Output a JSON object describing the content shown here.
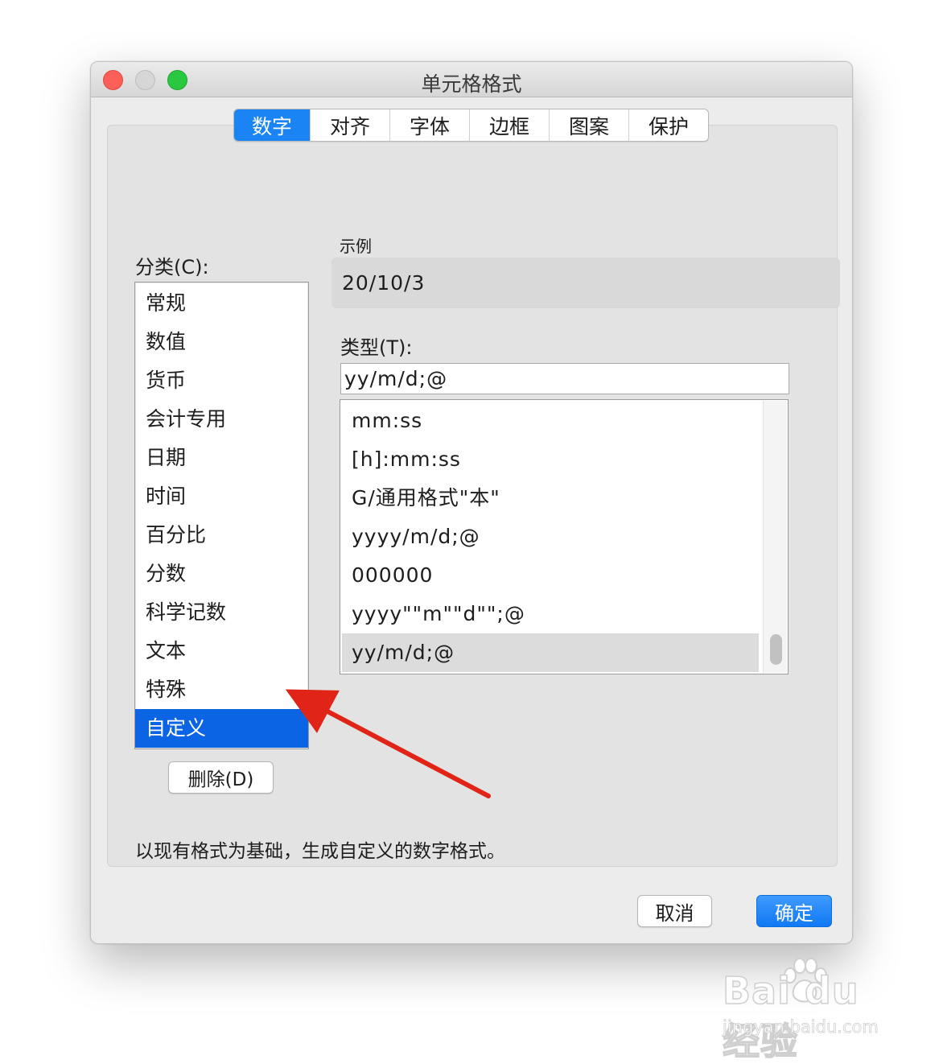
{
  "window": {
    "title": "单元格格式"
  },
  "tabs": [
    {
      "label": "数字",
      "active": true
    },
    {
      "label": "对齐",
      "active": false
    },
    {
      "label": "字体",
      "active": false
    },
    {
      "label": "边框",
      "active": false
    },
    {
      "label": "图案",
      "active": false
    },
    {
      "label": "保护",
      "active": false
    }
  ],
  "category": {
    "label": "分类(C):",
    "items": [
      "常规",
      "数值",
      "货币",
      "会计专用",
      "日期",
      "时间",
      "百分比",
      "分数",
      "科学记数",
      "文本",
      "特殊",
      "自定义"
    ],
    "selected": "自定义"
  },
  "delete_button": "删除(D)",
  "sample": {
    "label": "示例",
    "value": "20/10/3"
  },
  "type": {
    "label": "类型(T):",
    "value": "yy/m/d;@",
    "items": [
      "mm:ss",
      "[h]:mm:ss",
      "G/通用格式\"本\"",
      "yyyy/m/d;@",
      "000000",
      "yyyy\"\"m\"\"d\"\";@",
      "yy/m/d;@"
    ],
    "selected": "yy/m/d;@"
  },
  "description": "以现有格式为基础，生成自定义的数字格式。",
  "buttons": {
    "cancel": "取消",
    "ok": "确定"
  },
  "watermark": {
    "logo": "Bai du 经验",
    "url": "jingyan.baidu.com"
  },
  "colors": {
    "accent": "#1a84f5",
    "selection": "#0a64e4",
    "annotation_arrow": "#e02418"
  }
}
